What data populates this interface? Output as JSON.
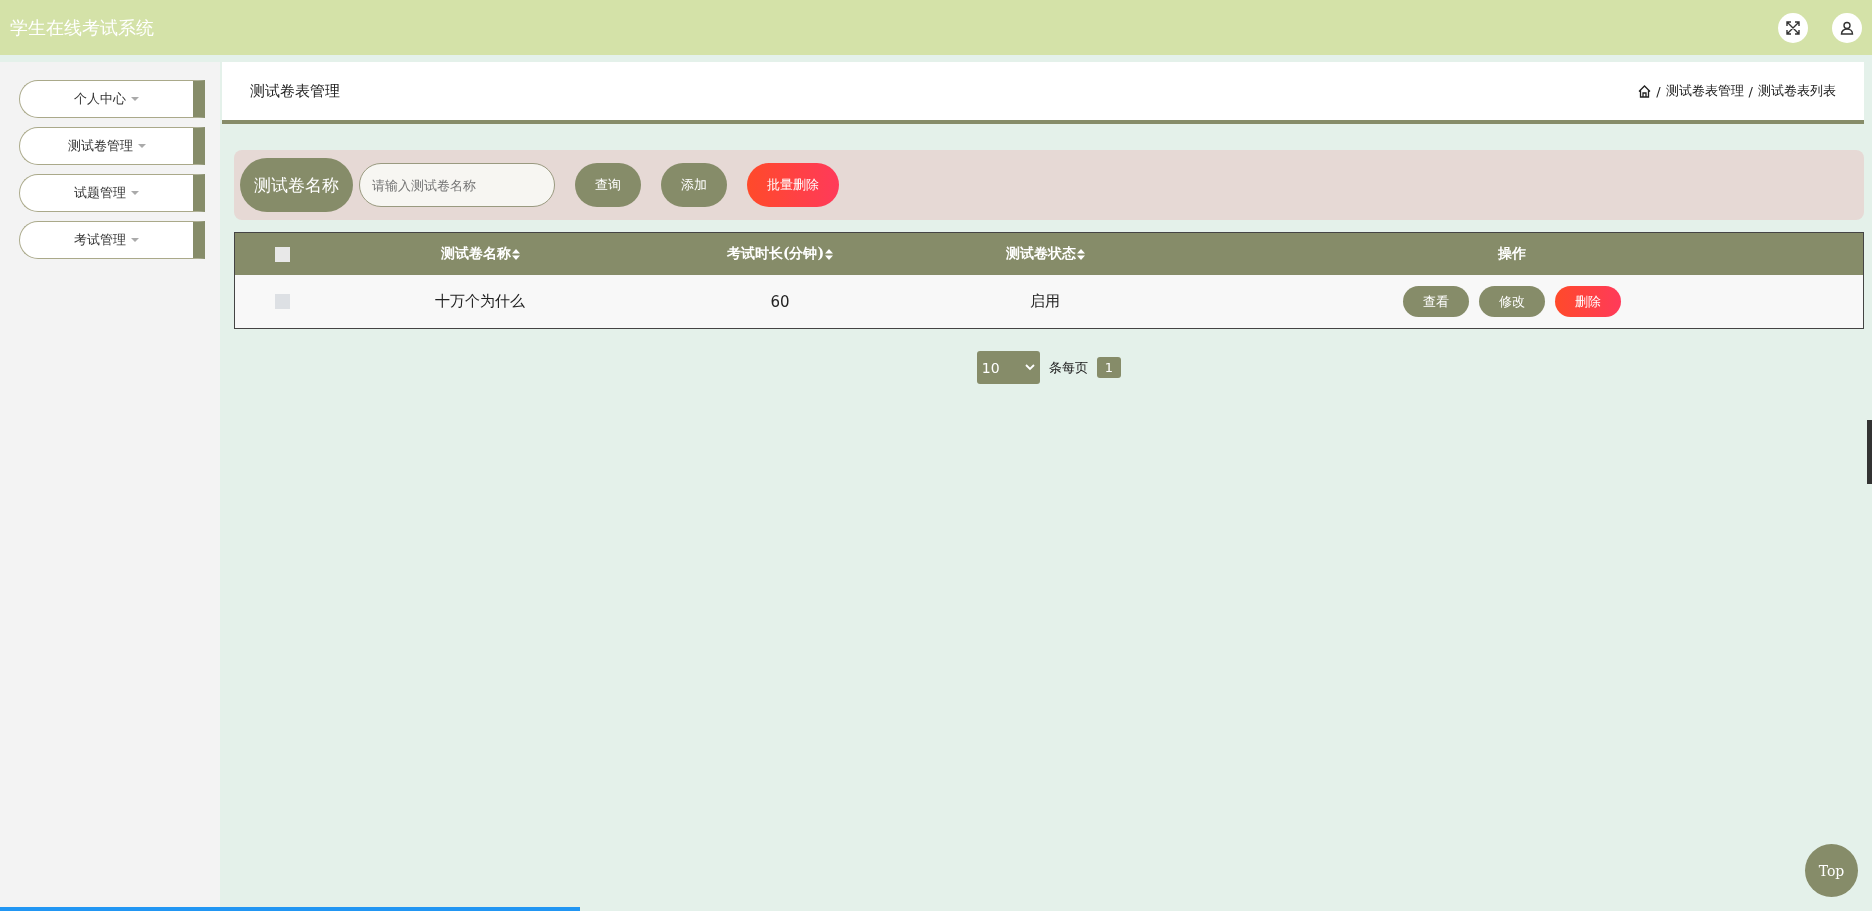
{
  "header": {
    "title": "学生在线考试系统"
  },
  "sidebar": {
    "items": [
      {
        "label": "个人中心"
      },
      {
        "label": "测试卷管理"
      },
      {
        "label": "试题管理"
      },
      {
        "label": "考试管理"
      }
    ]
  },
  "page": {
    "title": "测试卷表管理",
    "breadcrumb": [
      {
        "separator": "/",
        "label": "测试卷表管理"
      },
      {
        "separator": "/",
        "label": "测试卷表列表"
      }
    ]
  },
  "search": {
    "label": "测试卷名称",
    "placeholder": "请输入测试卷名称",
    "buttons": [
      {
        "label": "查询",
        "kind": "normal"
      },
      {
        "label": "添加",
        "kind": "normal"
      },
      {
        "label": "批量删除",
        "kind": "danger"
      }
    ]
  },
  "table": {
    "select_all_checked": false,
    "columns": [
      "测试卷名称",
      "考试时长(分钟)",
      "测试卷状态",
      "操作"
    ],
    "rows": [
      {
        "checked": false,
        "cells": [
          "十万个为什么",
          "60",
          "启用"
        ],
        "actions": [
          {
            "label": "查看",
            "kind": "normal"
          },
          {
            "label": "修改",
            "kind": "normal"
          },
          {
            "label": "删除",
            "kind": "danger"
          }
        ]
      }
    ]
  },
  "pagination": {
    "page_size": "10",
    "per_page_label": "条每页",
    "pages": [
      {
        "label": "1",
        "selected": true
      }
    ]
  },
  "back_to_top": "Top",
  "progress": {
    "level": 0.31
  }
}
